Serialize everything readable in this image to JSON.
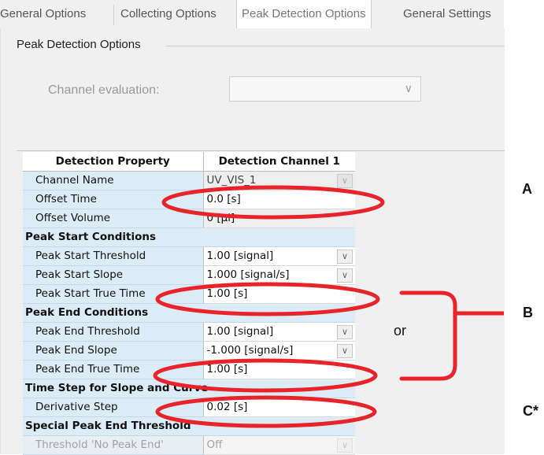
{
  "tabs": [
    {
      "label": "General Options"
    },
    {
      "label": "Collecting Options"
    },
    {
      "label": "Peak Detection Options"
    },
    {
      "label": "General Settings"
    }
  ],
  "group": {
    "title": "Peak Detection Options"
  },
  "channel": {
    "label": "Channel evaluation:",
    "value": ""
  },
  "grid": {
    "col1": "Detection Property",
    "col2": "Detection Channel 1",
    "rows": [
      {
        "name": "Channel Name",
        "value": "UV_VIS_1"
      },
      {
        "name": "Offset Time",
        "value": "0.0 [s]"
      },
      {
        "name": "Offset Volume",
        "value": "0 [µl]"
      },
      {
        "section": "Peak Start Conditions"
      },
      {
        "name": "Peak Start Threshold",
        "value": "1.00 [signal]"
      },
      {
        "name": "Peak Start Slope",
        "value": "1.000 [signal/s]"
      },
      {
        "name": "Peak Start True Time",
        "value": "1.00 [s]"
      },
      {
        "section": "Peak End Conditions"
      },
      {
        "name": "Peak End Threshold",
        "value": "1.00 [signal]"
      },
      {
        "name": "Peak End Slope",
        "value": "-1.000 [signal/s]"
      },
      {
        "name": "Peak End True Time",
        "value": "1.00 [s]"
      },
      {
        "section": "Time Step for Slope and Curve"
      },
      {
        "name": "Derivative Step",
        "value": "0.02 [s]"
      },
      {
        "section": "Special Peak End Threshold"
      },
      {
        "name": "Threshold 'No Peak End'",
        "value": "Off"
      }
    ]
  },
  "annotations": {
    "a": "A",
    "b": "B",
    "or": "or",
    "c": "C*"
  },
  "colors": {
    "highlight": "#e8232a",
    "row_bg": "#dcecf7"
  }
}
